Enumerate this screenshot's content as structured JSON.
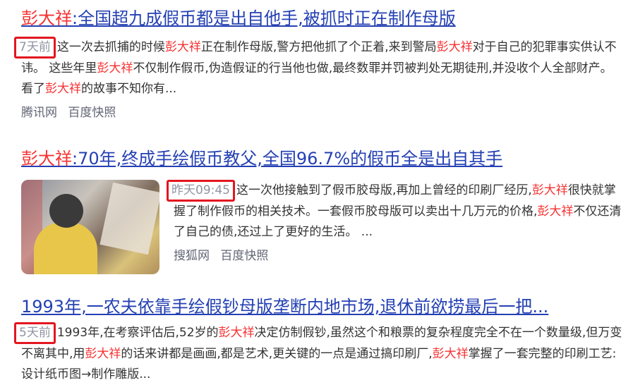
{
  "results": [
    {
      "title_kw": "彭大祥",
      "title_rest": ":全国超九成假币都是出自他手,被抓时正在制作母版",
      "date": "7天前",
      "abstract_parts": [
        "这一次去抓捕的时候",
        "彭大祥",
        "正在制作母版,警方把他抓了个正着,来到警局",
        "彭大祥",
        "对于自己的犯罪事实供认不讳。 这些年里",
        "彭大祥",
        "不仅制作假币,伪造假证的行当他也做,最终数罪并罚被判处无期徒刑,并没收个人全部财产。 看了",
        "彭大祥",
        "的故事不知你有..."
      ],
      "source": "腾讯网",
      "snapshot": "百度快照"
    },
    {
      "title_kw": "彭大祥",
      "title_rest": ":70年,终成手绘假币教父,全国96.7%的假币全是出自其手",
      "date": "昨天09:45",
      "abstract_parts": [
        "这一次他接触到了假币胶母版,再加上曾经的印刷厂经历,",
        "彭大祥",
        "很快就掌握了制作假币的相关技术。一套假币胶母版可以卖出十几万元的价格,",
        "彭大祥",
        "不仅还清了自己的债,还过上了更好的生活。 ..."
      ],
      "source": "搜狐网",
      "snapshot": "百度快照"
    },
    {
      "title": "1993年,一农夫依靠手绘假钞母版垄断内地市场,退休前欲捞最后一把...",
      "date": "5天前",
      "abstract_parts": [
        "1993年,在考察评估后,52岁的",
        "彭大祥",
        "决定仿制假钞,虽然这个和粮票的复杂程度完全不在一个数量级,但万变不离其中,用",
        "彭大祥",
        "的话来讲都是画画,都是艺术,更关键的一点是通过搞印刷厂,",
        "彭大祥",
        "掌握了一套完整的印刷工艺:设计纸币图→制作雕版..."
      ]
    }
  ]
}
